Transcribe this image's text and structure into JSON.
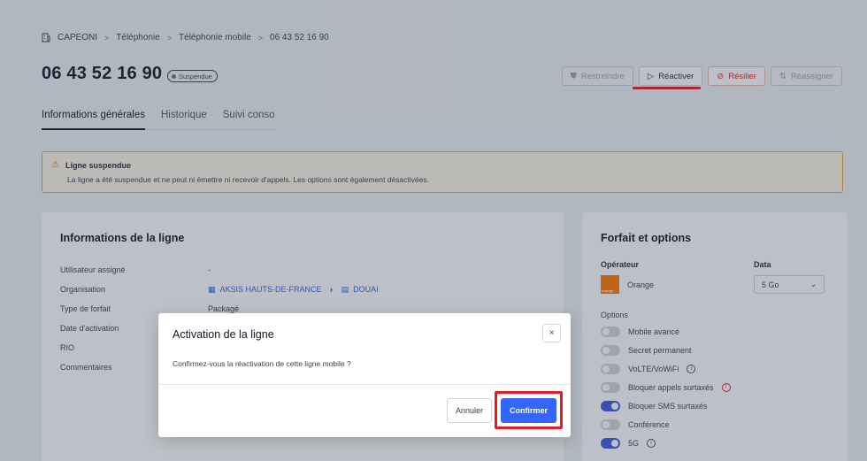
{
  "breadcrumb": {
    "items": [
      "CAPEONI",
      "Téléphonie",
      "Téléphonie mobile",
      "06 43 52 16 90"
    ],
    "separator": ">"
  },
  "header": {
    "title": "06 43 52 16 90",
    "status_badge": "Suspendue"
  },
  "actions": {
    "restreindre": "Restreindre",
    "reactiver": "Réactiver",
    "resilier": "Résilier",
    "reassigner": "Réassigner"
  },
  "tabs": [
    "Informations générales",
    "Historique",
    "Suivi conso"
  ],
  "alert": {
    "title": "Ligne suspendue",
    "text": "La ligne a été suspendue et ne peut ni émettre ni recevoir d'appels. Les options sont également désactivées."
  },
  "line_info": {
    "title": "Informations de la ligne",
    "rows": [
      {
        "label": "Utilisateur assigné",
        "value": "-"
      },
      {
        "label": "Organisation",
        "value": ""
      },
      {
        "label": "Type de forfait",
        "value": "Packagé"
      },
      {
        "label": "Date d'activation",
        "value": ""
      },
      {
        "label": "RIO",
        "value": ""
      },
      {
        "label": "Commentaires",
        "value": ""
      }
    ],
    "org_link_1": "AKSIS HAUTS-DE-FRANCE",
    "org_link_2": "DOUAI"
  },
  "plan": {
    "title": "Forfait et options",
    "operator_label": "Opérateur",
    "data_label": "Data",
    "operator_name": "Orange",
    "operator_logo_text": "orange",
    "data_value": "5 Go",
    "options_label": "Options",
    "options": [
      {
        "label": "Mobile avancé",
        "on": false
      },
      {
        "label": "Secret permanent",
        "on": false
      },
      {
        "label": "VoLTE/VoWiFi",
        "on": false
      },
      {
        "label": "Bloquer appels surtaxés",
        "on": false
      },
      {
        "label": "Bloquer SMS surtaxés",
        "on": true
      },
      {
        "label": "Conférence",
        "on": false
      },
      {
        "label": "5G",
        "on": true
      }
    ]
  },
  "modal": {
    "title": "Activation de la ligne",
    "body": "Confirmez-vous la réactivation de cette ligne mobile ?",
    "cancel": "Annuler",
    "confirm": "Confirmer",
    "close_glyph": "×"
  },
  "colors": {
    "accent": "#3366ff",
    "highlight": "#e11d2a",
    "orange": "#ff7900",
    "alert_border": "#e8a33b"
  }
}
